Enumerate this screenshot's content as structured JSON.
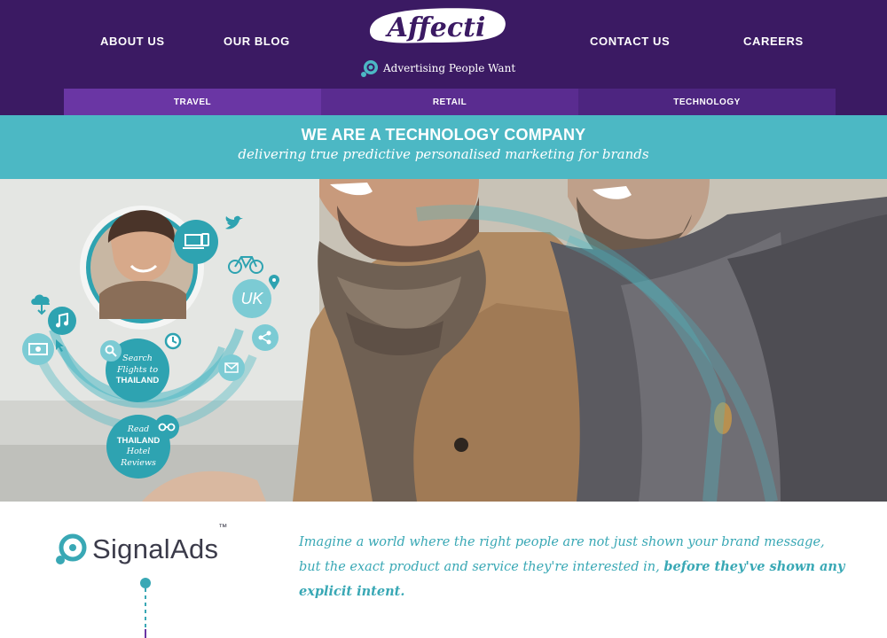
{
  "nav": {
    "about": "ABOUT US",
    "blog": "OUR BLOG",
    "contact": "CONTACT US",
    "careers": "CAREERS"
  },
  "brand": {
    "logo_text": "Affecti",
    "tagline": "Advertising People Want"
  },
  "tabs": [
    {
      "label": "TRAVEL"
    },
    {
      "label": "RETAIL"
    },
    {
      "label": "TECHNOLOGY"
    }
  ],
  "banner": {
    "title": "WE ARE A TECHNOLOGY COMPANY",
    "subtitle": "delivering true predictive personalised marketing for brands"
  },
  "hero": {
    "badge_country": "UK",
    "search_bubble": {
      "line1": "Search",
      "line2": "Flights to",
      "line3": "THAILAND"
    },
    "review_bubble": {
      "line1": "Read",
      "line2": "THAILAND",
      "line3": "Hotel",
      "line4": "Reviews"
    },
    "icons": [
      "twitter-icon",
      "laptop-phone-icon",
      "bicycle-icon",
      "location-pin-icon",
      "share-icon",
      "email-icon",
      "clock-icon",
      "magnifier-icon",
      "glasses-icon",
      "cloud-download-icon",
      "music-icon",
      "money-icon",
      "cursor-icon"
    ]
  },
  "signalads": {
    "name": "SignalAds",
    "tm": "™"
  },
  "intro": {
    "text": "Imagine a world where the right people are not just shown your brand message, but the exact product and service they're interested in, ",
    "emphasis": "before they've shown any explicit intent."
  },
  "colors": {
    "header_purple": "#3b1a63",
    "tab_purple": "#6a36a4",
    "accent_teal": "#4cb8c4",
    "bubble_teal": "#2ea3b1"
  }
}
